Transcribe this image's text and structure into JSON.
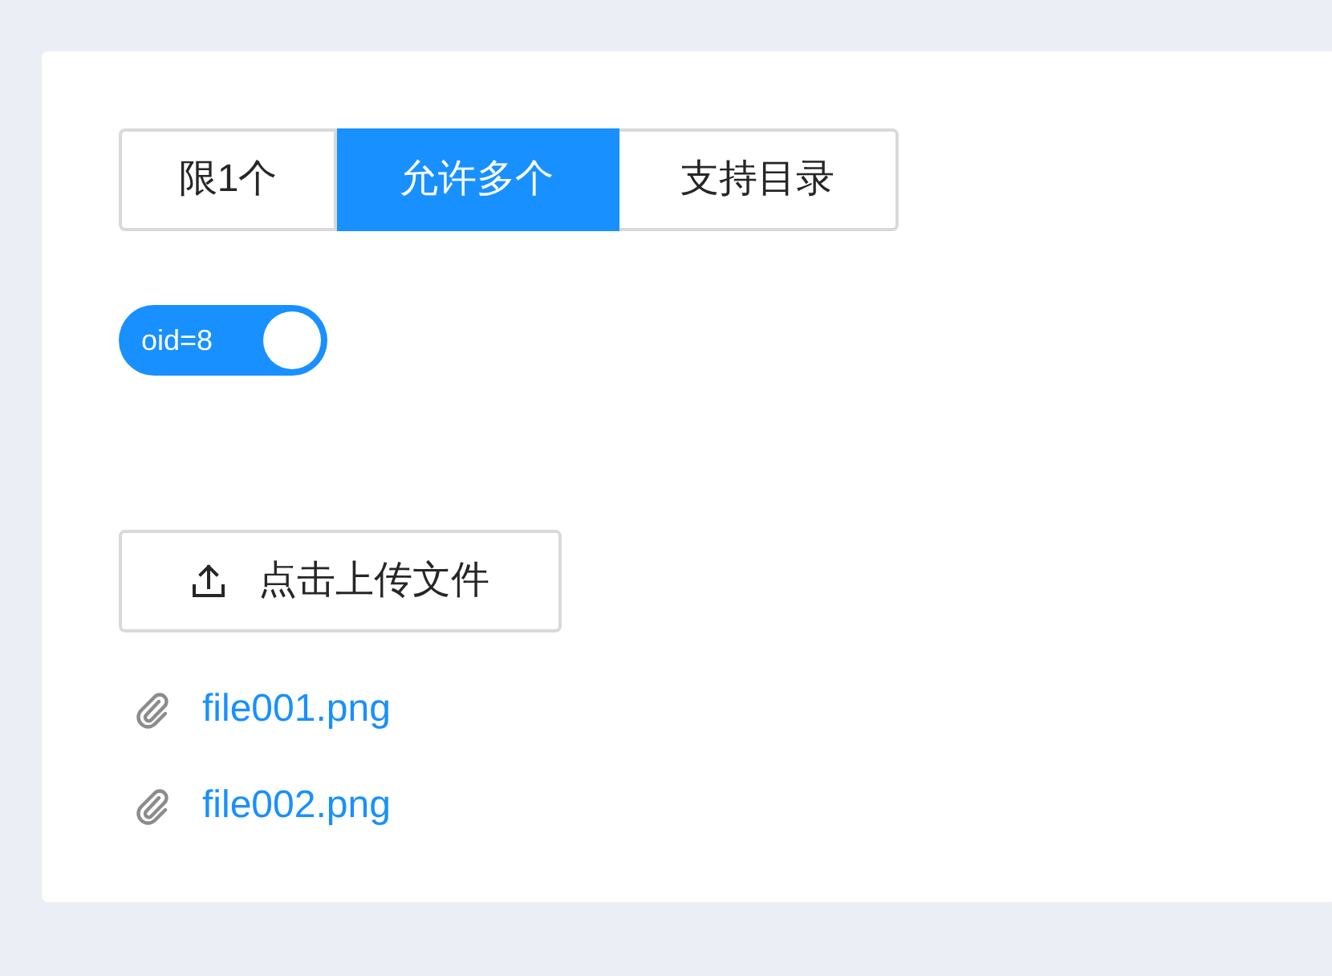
{
  "radio_group": [
    {
      "label": "限1个",
      "selected": false
    },
    {
      "label": "允许多个",
      "selected": true
    },
    {
      "label": "支持目录",
      "selected": false
    }
  ],
  "toggle": {
    "label": "oid=8",
    "on": true
  },
  "upload_button": {
    "label": "点击上传文件"
  },
  "files": [
    {
      "name": "file001.png"
    },
    {
      "name": "file002.png"
    }
  ]
}
